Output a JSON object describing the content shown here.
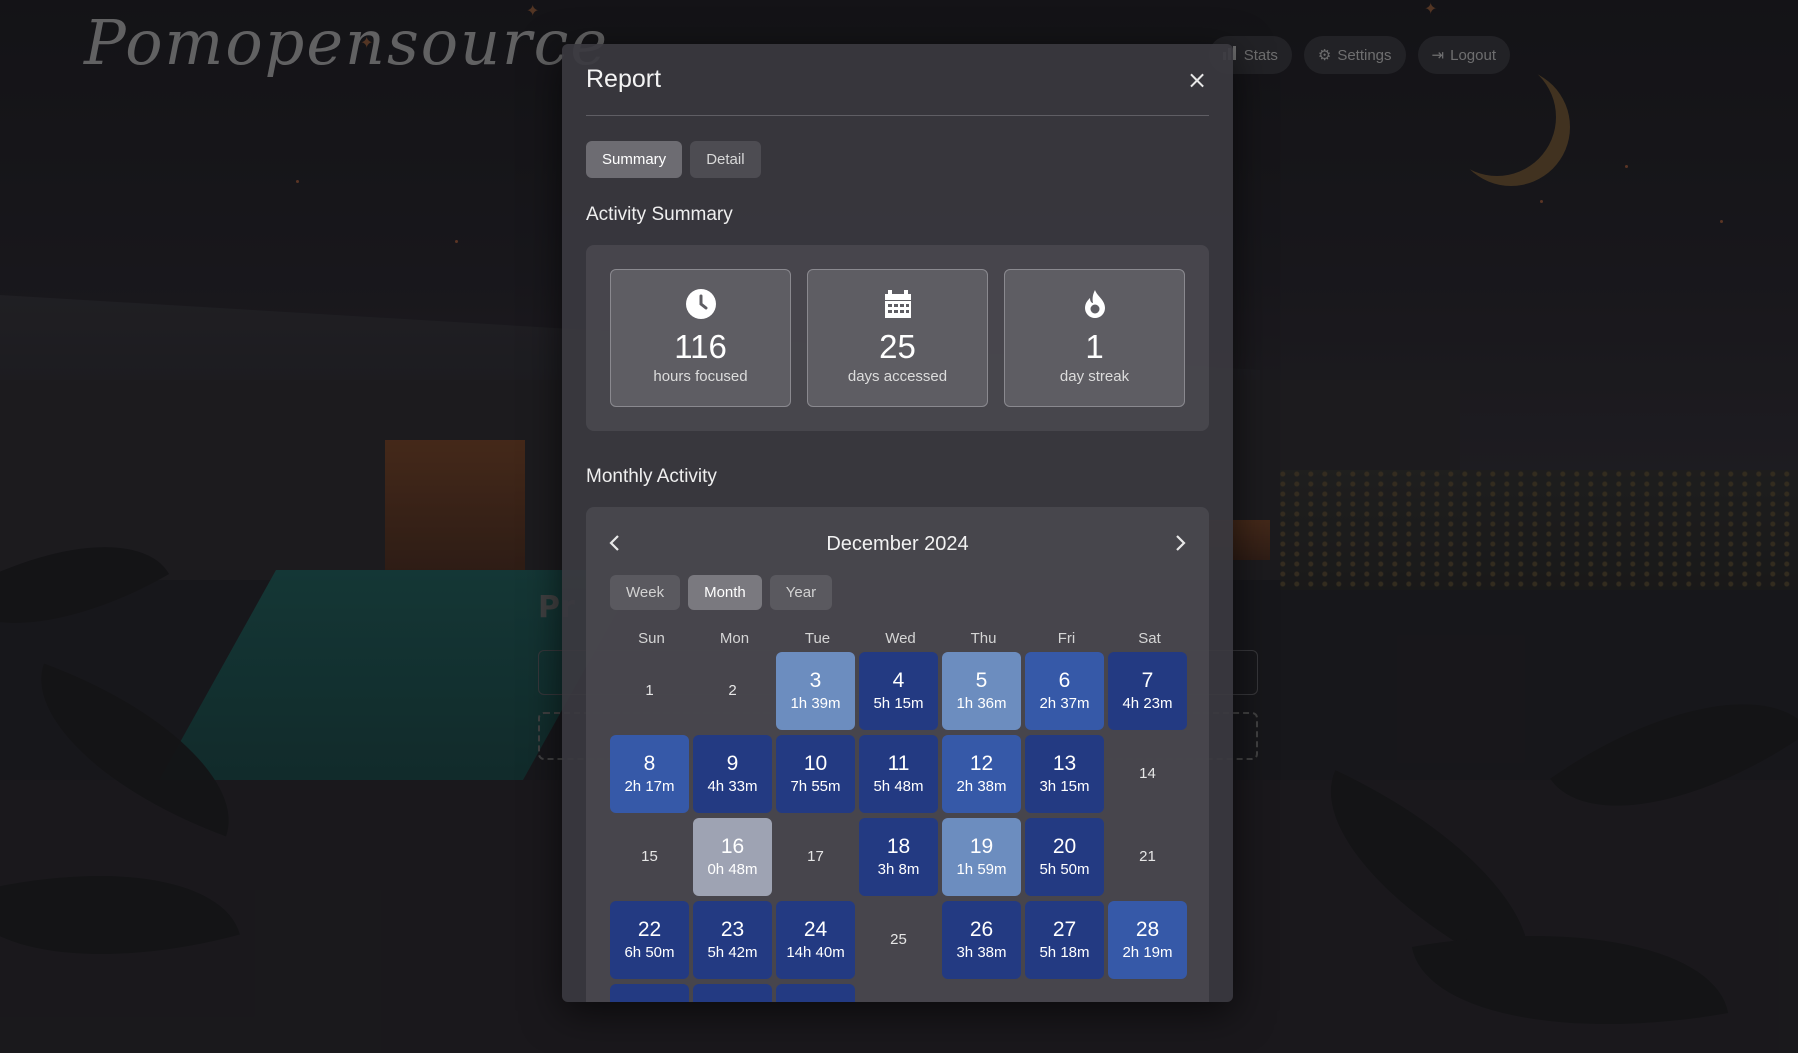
{
  "app": {
    "brand": "Pomopensource"
  },
  "nav": [
    {
      "label": "Stats",
      "icon": "bar-chart-icon"
    },
    {
      "label": "Settings",
      "icon": "gear-icon"
    },
    {
      "label": "Logout",
      "icon": "logout-icon"
    }
  ],
  "background": {
    "heading": "Pr"
  },
  "modal": {
    "title": "Report",
    "close_label": "×",
    "tabs": [
      {
        "label": "Summary",
        "active": true
      },
      {
        "label": "Detail",
        "active": false
      }
    ],
    "activity_summary_title": "Activity Summary",
    "stats": [
      {
        "value": "116",
        "label": "hours focused",
        "icon": "clock-icon"
      },
      {
        "value": "25",
        "label": "days accessed",
        "icon": "calendar-icon"
      },
      {
        "value": "1",
        "label": "day streak",
        "icon": "fire-icon"
      }
    ],
    "monthly_activity_title": "Monthly Activity",
    "calendar": {
      "month_label": "December 2024",
      "prev_label": "‹",
      "next_label": "›",
      "range_tabs": [
        {
          "label": "Week",
          "active": false
        },
        {
          "label": "Month",
          "active": true
        },
        {
          "label": "Year",
          "active": false
        }
      ],
      "weekdays": [
        "Sun",
        "Mon",
        "Tue",
        "Wed",
        "Thu",
        "Fri",
        "Sat"
      ],
      "days": [
        {
          "day": "1",
          "duration": "",
          "level": 0
        },
        {
          "day": "2",
          "duration": "",
          "level": 0
        },
        {
          "day": "3",
          "duration": "1h 39m",
          "level": 1
        },
        {
          "day": "4",
          "duration": "5h 15m",
          "level": 3
        },
        {
          "day": "5",
          "duration": "1h 36m",
          "level": 1
        },
        {
          "day": "6",
          "duration": "2h 37m",
          "level": 2
        },
        {
          "day": "7",
          "duration": "4h 23m",
          "level": 3
        },
        {
          "day": "8",
          "duration": "2h 17m",
          "level": 2
        },
        {
          "day": "9",
          "duration": "4h 33m",
          "level": 3
        },
        {
          "day": "10",
          "duration": "7h 55m",
          "level": 3
        },
        {
          "day": "11",
          "duration": "5h 48m",
          "level": 3
        },
        {
          "day": "12",
          "duration": "2h 38m",
          "level": 2
        },
        {
          "day": "13",
          "duration": "3h 15m",
          "level": 3
        },
        {
          "day": "14",
          "duration": "",
          "level": 0
        },
        {
          "day": "15",
          "duration": "",
          "level": 0
        },
        {
          "day": "16",
          "duration": "0h 48m",
          "level": 0.5
        },
        {
          "day": "17",
          "duration": "",
          "level": 0
        },
        {
          "day": "18",
          "duration": "3h 8m",
          "level": 3
        },
        {
          "day": "19",
          "duration": "1h 59m",
          "level": 1
        },
        {
          "day": "20",
          "duration": "5h 50m",
          "level": 3
        },
        {
          "day": "21",
          "duration": "",
          "level": 0
        },
        {
          "day": "22",
          "duration": "6h 50m",
          "level": 3
        },
        {
          "day": "23",
          "duration": "5h 42m",
          "level": 3
        },
        {
          "day": "24",
          "duration": "14h 40m",
          "level": 3
        },
        {
          "day": "25",
          "duration": "",
          "level": 0
        },
        {
          "day": "26",
          "duration": "3h 38m",
          "level": 3
        },
        {
          "day": "27",
          "duration": "5h 18m",
          "level": 3
        },
        {
          "day": "28",
          "duration": "2h 19m",
          "level": 2
        }
      ],
      "colors": {
        "level_0_5": "#9ea3b3",
        "level_1": "#6c8dbf",
        "level_2": "#3659a8",
        "level_3": "#233a82"
      }
    }
  }
}
